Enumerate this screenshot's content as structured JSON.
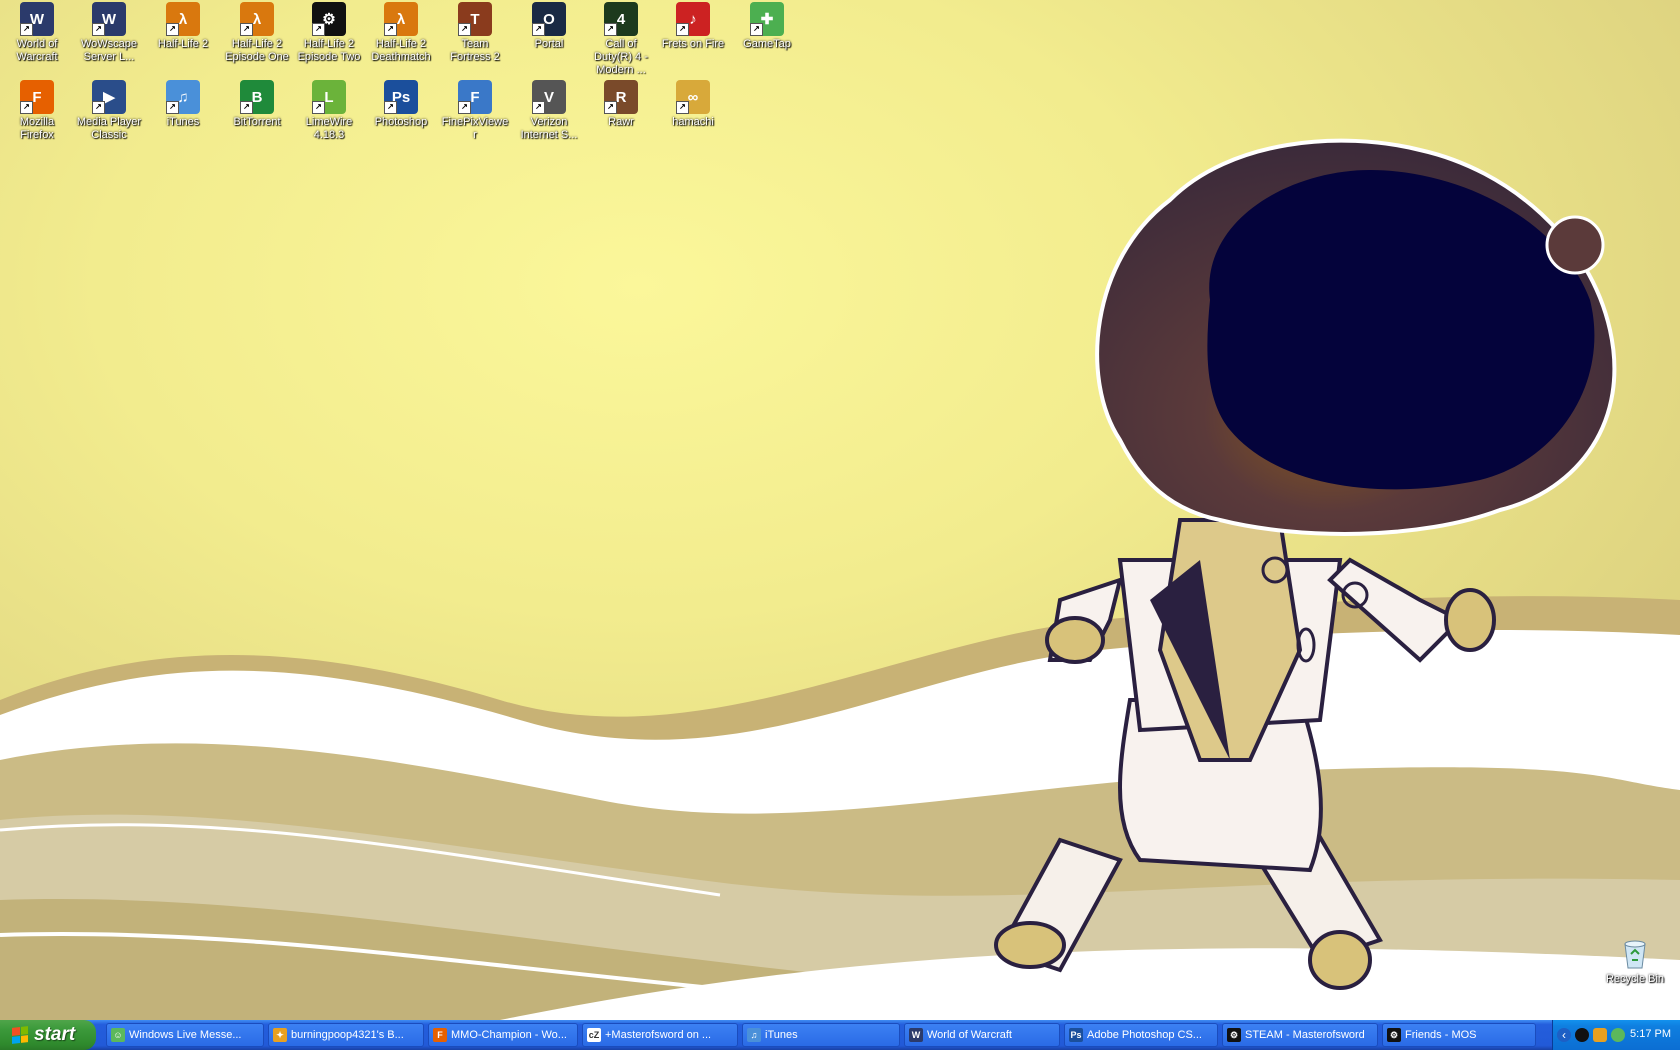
{
  "desktop": {
    "icons": [
      {
        "label": "World of Warcraft",
        "icon": "wow-icon",
        "color": "#2b3a6b",
        "glyph": "W"
      },
      {
        "label": "WoWscape Server L...",
        "icon": "wow-icon",
        "color": "#2b3a6b",
        "glyph": "W"
      },
      {
        "label": "Half-Life 2",
        "icon": "half-life-icon",
        "color": "#d9780e",
        "glyph": "λ"
      },
      {
        "label": "Half-Life 2 Episode One",
        "icon": "half-life-icon",
        "color": "#d9780e",
        "glyph": "λ"
      },
      {
        "label": "Half-Life 2 Episode Two",
        "icon": "steam-icon",
        "color": "#111111",
        "glyph": "⚙"
      },
      {
        "label": "Half-Life 2 Deathmatch",
        "icon": "half-life-icon",
        "color": "#d9780e",
        "glyph": "λ"
      },
      {
        "label": "Team Fortress 2",
        "icon": "tf2-icon",
        "color": "#8a3b1d",
        "glyph": "T"
      },
      {
        "label": "Portal",
        "icon": "portal-icon",
        "color": "#1a2a44",
        "glyph": "O"
      },
      {
        "label": "Call of Duty(R) 4 - Modern ...",
        "icon": "cod-icon",
        "color": "#1d3a1d",
        "glyph": "4"
      },
      {
        "label": "Frets on Fire",
        "icon": "frets-icon",
        "color": "#cc2222",
        "glyph": "♪"
      },
      {
        "label": "GameTap",
        "icon": "gametap-icon",
        "color": "#4caf50",
        "glyph": "✚"
      },
      {
        "label": "Mozilla Firefox",
        "icon": "firefox-icon",
        "color": "#e66000",
        "glyph": "F"
      },
      {
        "label": "Media Player Classic",
        "icon": "media-player-icon",
        "color": "#2a4d8a",
        "glyph": "▶"
      },
      {
        "label": "iTunes",
        "icon": "itunes-icon",
        "color": "#4a90d9",
        "glyph": "♫"
      },
      {
        "label": "BitTorrent",
        "icon": "bittorrent-icon",
        "color": "#1f8a3a",
        "glyph": "B"
      },
      {
        "label": "LimeWire 4.18.3",
        "icon": "limewire-icon",
        "color": "#6bb33a",
        "glyph": "L"
      },
      {
        "label": "Photoshop",
        "icon": "photoshop-icon",
        "color": "#1b4f9c",
        "glyph": "Ps"
      },
      {
        "label": "FinePixViewer",
        "icon": "finepix-icon",
        "color": "#3a78c8",
        "glyph": "F"
      },
      {
        "label": "Verizon Internet S...",
        "icon": "verizon-icon",
        "color": "#555555",
        "glyph": "V"
      },
      {
        "label": "Rawr",
        "icon": "rawr-icon",
        "color": "#7a4a2a",
        "glyph": "R"
      },
      {
        "label": "hamachi",
        "icon": "hamachi-icon",
        "color": "#d8a93a",
        "glyph": "∞"
      }
    ],
    "recycle_bin": {
      "label": "Recycle Bin",
      "icon": "recycle-bin-icon"
    }
  },
  "taskbar": {
    "start_label": "start",
    "buttons": [
      {
        "label": "Windows Live Messe...",
        "icon": "messenger-icon",
        "color": "#5cb85c",
        "glyph": "☺"
      },
      {
        "label": "burningpoop4321's B...",
        "icon": "runner-icon",
        "color": "#e8a020",
        "glyph": "✦"
      },
      {
        "label": "MMO-Champion - Wo...",
        "icon": "firefox-icon",
        "color": "#e66000",
        "glyph": "F"
      },
      {
        "label": "+Masterofsword on ...",
        "icon": "chatzilla-icon",
        "color": "#ffffff",
        "glyph": "cZ"
      },
      {
        "label": "iTunes",
        "icon": "itunes-icon",
        "color": "#4a90d9",
        "glyph": "♫"
      },
      {
        "label": "World of Warcraft",
        "icon": "wow-icon",
        "color": "#2b3a6b",
        "glyph": "W"
      },
      {
        "label": "Adobe Photoshop CS...",
        "icon": "photoshop-icon",
        "color": "#1b4f9c",
        "glyph": "Ps"
      },
      {
        "label": "STEAM - Masterofsword",
        "icon": "steam-icon",
        "color": "#111111",
        "glyph": "⚙"
      },
      {
        "label": "Friends - MOS",
        "icon": "steam-icon",
        "color": "#111111",
        "glyph": "⚙"
      }
    ],
    "tray_icons": [
      "chevron-left-icon",
      "steam-icon",
      "runner-icon",
      "messenger-icon"
    ],
    "clock": "5:17 PM"
  }
}
